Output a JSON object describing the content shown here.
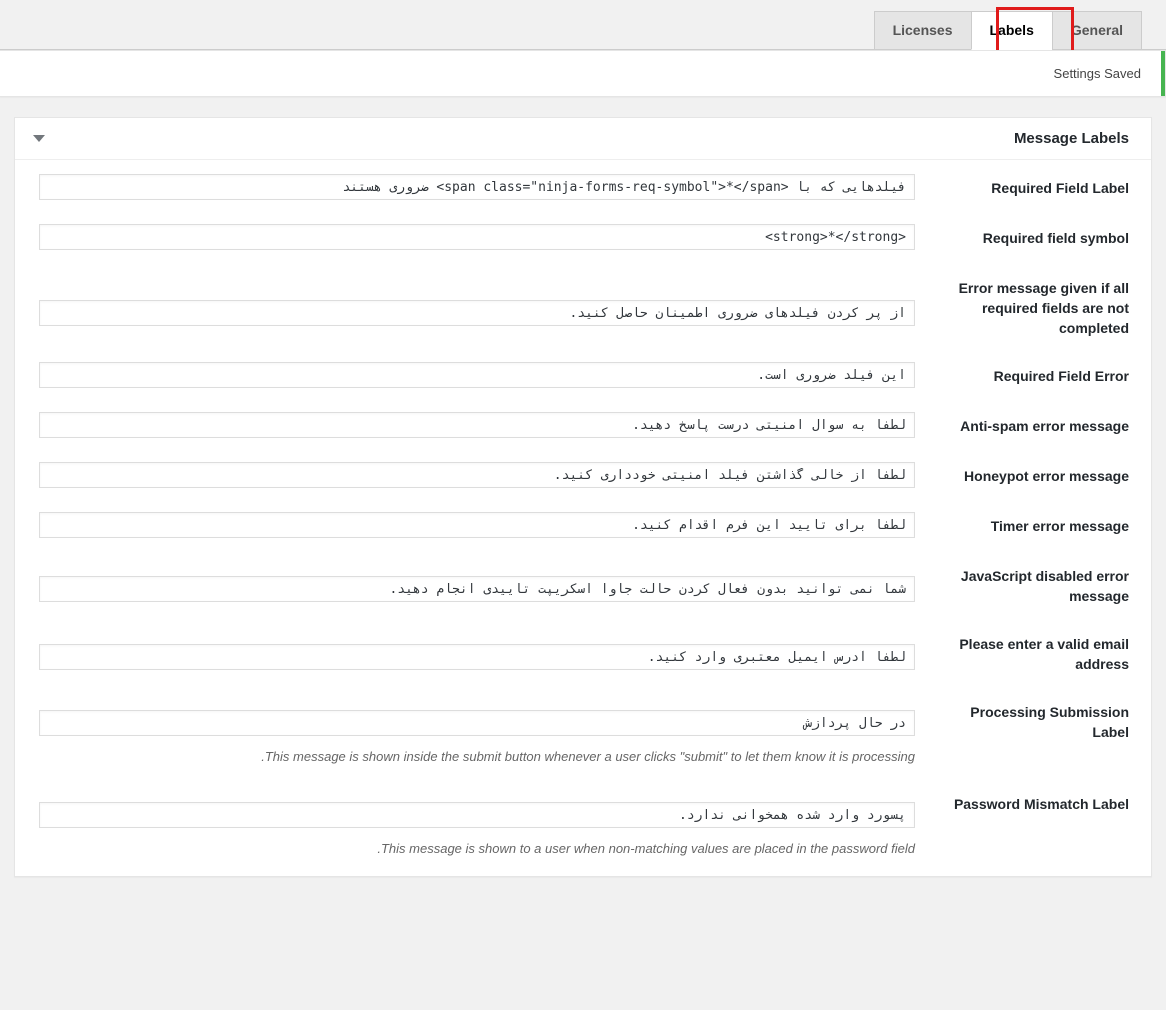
{
  "tabs": [
    {
      "label": "Licenses",
      "active": false,
      "highlighted": false
    },
    {
      "label": "Labels",
      "active": true,
      "highlighted": true
    },
    {
      "label": "General",
      "active": false,
      "highlighted": false
    }
  ],
  "notice": {
    "text": "Settings Saved",
    "accent_color": "#46b450"
  },
  "panel": {
    "title": "Message Labels",
    "toggle_icon": "triangle-down-icon"
  },
  "highlight_color": "#e01b1b",
  "fields": [
    {
      "label": "Required Field Label",
      "value": "فیلدهایی که با <span class=\"ninja-forms-req-symbol\">*</span> ضروری هستند",
      "description": ""
    },
    {
      "label": "Required field symbol",
      "value": "<strong>*</strong>",
      "description": ""
    },
    {
      "label": "Error message given if all required fields are not completed",
      "value": "از پر کردن فیلدهای ضروری اطمینان حاصل کنید.",
      "description": ""
    },
    {
      "label": "Required Field Error",
      "value": "این فیلد ضروری است.",
      "description": ""
    },
    {
      "label": "Anti-spam error message",
      "value": "لطفا به سوال امنیتی درست پاسخ دهید.",
      "description": ""
    },
    {
      "label": "Honeypot error message",
      "value": "لطفا از خالی گذاشتن فیلد امنیتی خودداری کنید.",
      "description": ""
    },
    {
      "label": "Timer error message",
      "value": "لطفا برای تایید این فرم اقدام کنید.",
      "description": ""
    },
    {
      "label": "JavaScript disabled error message",
      "value": "شما نمی توانید بدون فعال کردن حالت جاوا اسکریپت تاییدی انجام دهید.",
      "description": ""
    },
    {
      "label": "Please enter a valid email address",
      "value": "لطفا آدرس ایمیل معتبری وارد کنید.",
      "description": ""
    },
    {
      "label": "Processing Submission Label",
      "value": "در حال پردازش",
      "description": "This message is shown inside the submit button whenever a user clicks \"submit\" to let them know it is processing."
    },
    {
      "label": "Password Mismatch Label",
      "value": "پسورد وارد شده همخوانی ندارد.",
      "description": "This message is shown to a user when non-matching values are placed in the password field."
    }
  ]
}
